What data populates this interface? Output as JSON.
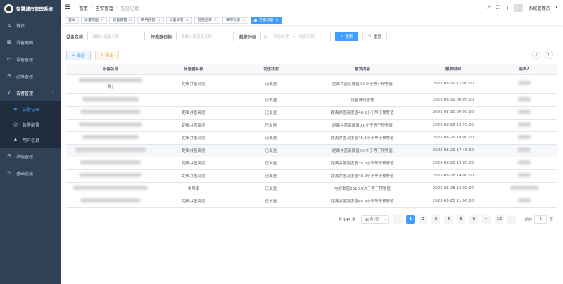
{
  "app": {
    "title": "智慧城市管理系统"
  },
  "sidebar": {
    "items": [
      {
        "label": "首页",
        "icon": "home-icon"
      },
      {
        "label": "设备地图",
        "icon": "map-icon"
      },
      {
        "label": "设备管理",
        "icon": "monitor-icon"
      },
      {
        "label": "运维管理",
        "icon": "gear-icon"
      },
      {
        "label": "告警管理",
        "icon": "bell-icon"
      },
      {
        "label": "告警记录",
        "icon": "record-icon"
      },
      {
        "label": "告警配置",
        "icon": "config-icon"
      },
      {
        "label": "用户信息",
        "icon": "user-icon"
      },
      {
        "label": "系统管理",
        "icon": "settings-icon"
      },
      {
        "label": "基础设施",
        "icon": "infrastructure-icon"
      }
    ]
  },
  "breadcrumb": [
    "首页",
    "告警管理",
    "告警记录"
  ],
  "navbar": {
    "user": "系统管理员"
  },
  "tags": [
    "首页",
    "设备地图",
    "设备管理",
    "天气预报",
    "设备状态",
    "巡检记录",
    "维修记录",
    "告警记录"
  ],
  "search": {
    "device_label": "设备名称",
    "device_placeholder": "请输入设备名称",
    "sensor_label": "传感器名称",
    "sensor_placeholder": "请输入传感器名称",
    "time_label": "触发时间",
    "start_placeholder": "开始日期",
    "range_sep": "-",
    "end_placeholder": "结束日期",
    "search_btn": "搜索",
    "reset_btn": "重置"
  },
  "toolbar": {
    "add_btn": "新增",
    "export_btn": "导出"
  },
  "table": {
    "headers": [
      "设备名称",
      "传感器名称",
      "发送状态",
      "触发内容",
      "触发时间",
      "接收人"
    ],
    "rows": [
      {
        "device_suffix": "角)",
        "sensor": "距离井盖高度",
        "status": "已发送",
        "content": "距离井盖高度值0.0小于等于预警值",
        "time": "2025-08-31 17:00:00"
      },
      {
        "device_suffix": "",
        "sensor": "",
        "status": "已发送",
        "content": "设备离线告警",
        "time": "2025-08-31 00:05:00"
      },
      {
        "device_suffix": "",
        "sensor": "距离井盖高度",
        "status": "已发送",
        "content": "距离井盖高度值46.1小于等于预警值",
        "time": "2025-08-30 00:00:00"
      },
      {
        "device_suffix": "",
        "sensor": "距离井盖高度",
        "status": "已发送",
        "content": "距离井盖高度值0.0小于等于预警值",
        "time": "2025-08-29 19:55:00"
      },
      {
        "device_suffix": "",
        "sensor": "距离井盖高度",
        "status": "已发送",
        "content": "距离井盖高度值45.1小于等于预警值",
        "time": "2025-08-29 18:00:00"
      },
      {
        "device_suffix": "",
        "sensor": "距离井盖高度",
        "status": "已发送",
        "content": "距离井盖高度值0.0小于等于预警值",
        "time": "2025-08-29 17:45:00"
      },
      {
        "device_suffix": "",
        "sensor": "距离井盖高度",
        "status": "已发送",
        "content": "距离井盖高度值39.6小于等于预警值",
        "time": "2025-08-28 19:00:00"
      },
      {
        "device_suffix": "",
        "sensor": "距离井盖高度",
        "status": "已发送",
        "content": "距离井盖高度值48.9小于等于预警值",
        "time": "2025-08-28 14:00:00"
      },
      {
        "device_suffix": "",
        "sensor": "电导率",
        "status": "已发送",
        "content": "电导率值3318.0大于等于预警值",
        "time": "2025-08-28 12:00:00"
      },
      {
        "device_suffix": "",
        "sensor": "距离井盖高度",
        "status": "已发送",
        "content": "距离井盖高度值48.4小于等于预警值",
        "time": "2025-08-28 11:00:00"
      }
    ]
  },
  "pagination": {
    "total": "共 144 条",
    "page_size": "10条/页",
    "pages": [
      "1",
      "2",
      "3",
      "4",
      "5",
      "6",
      "···",
      "15"
    ],
    "prev": "‹",
    "next": "›",
    "jump_label": "前往",
    "jump_value": "1",
    "jump_suffix": "页"
  }
}
